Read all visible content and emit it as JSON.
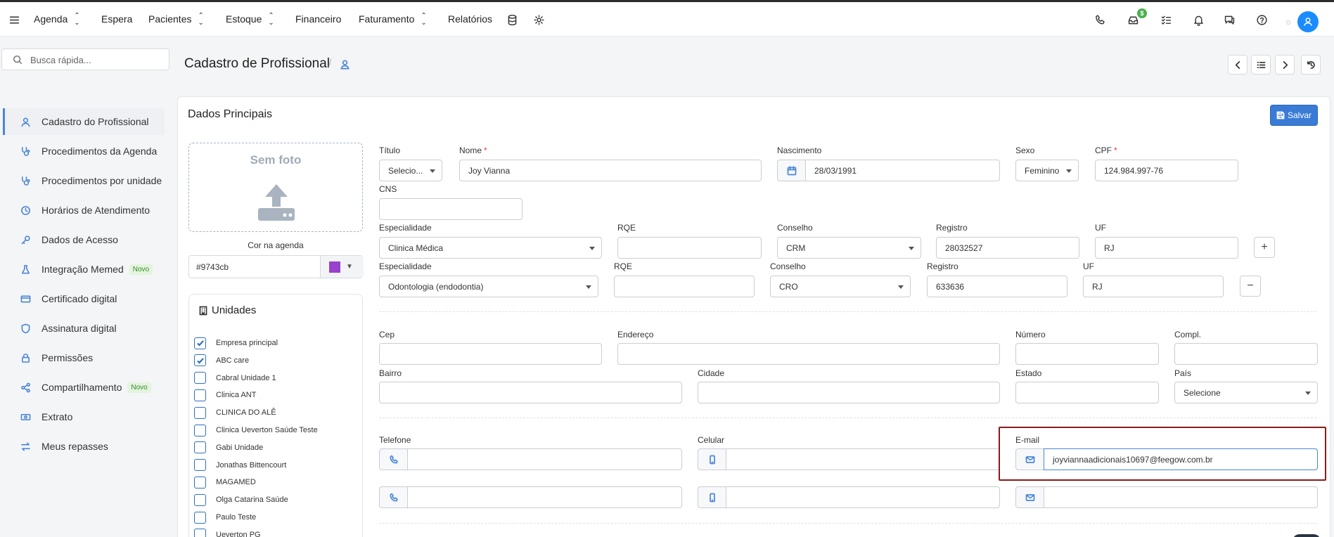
{
  "nav": {
    "items": [
      {
        "label": "Agenda",
        "dropdown": true
      },
      {
        "label": "Espera",
        "dropdown": false
      },
      {
        "label": "Pacientes",
        "dropdown": true
      },
      {
        "label": "Estoque",
        "dropdown": true
      },
      {
        "label": "Financeiro",
        "dropdown": false
      },
      {
        "label": "Faturamento",
        "dropdown": true
      },
      {
        "label": "Relatórios",
        "dropdown": false
      }
    ],
    "dollar_badge": "$"
  },
  "search": {
    "placeholder": "Busca rápida..."
  },
  "page": {
    "title": "Cadastro de Profissional",
    "separator": "/"
  },
  "sidebar": {
    "items": [
      {
        "label": "Cadastro do Profissional",
        "active": true,
        "badge": ""
      },
      {
        "label": "Procedimentos da Agenda",
        "badge": ""
      },
      {
        "label": "Procedimentos por unidade",
        "badge": ""
      },
      {
        "label": "Horários de Atendimento",
        "badge": ""
      },
      {
        "label": "Dados de Acesso",
        "badge": ""
      },
      {
        "label": "Integração Memed",
        "badge": "Novo"
      },
      {
        "label": "Certificado digital",
        "badge": ""
      },
      {
        "label": "Assinatura digital",
        "badge": ""
      },
      {
        "label": "Permissões",
        "badge": ""
      },
      {
        "label": "Compartilhamento",
        "badge": "Novo"
      },
      {
        "label": "Extrato",
        "badge": ""
      },
      {
        "label": "Meus repasses",
        "badge": ""
      }
    ]
  },
  "section": {
    "title": "Dados Principais",
    "save_label": "Salvar"
  },
  "photo": {
    "placeholder": "Sem foto"
  },
  "color": {
    "label": "Cor na agenda",
    "value": "#9743cb",
    "swatch": "#9743cb"
  },
  "units": {
    "title": "Unidades",
    "items": [
      {
        "label": "Empresa principal",
        "checked": true
      },
      {
        "label": "ABC care",
        "checked": true
      },
      {
        "label": "Cabral Unidade 1",
        "checked": false
      },
      {
        "label": "Clinica ANT",
        "checked": false
      },
      {
        "label": "CLINICA DO ALÊ",
        "checked": false
      },
      {
        "label": "Clinica Ueverton Saúde Teste",
        "checked": false
      },
      {
        "label": "Gabi Unidade",
        "checked": false
      },
      {
        "label": "Jonathas Bittencourt",
        "checked": false
      },
      {
        "label": "MAGAMED",
        "checked": false
      },
      {
        "label": "Olga Catarina Saúde",
        "checked": false
      },
      {
        "label": "Paulo Teste",
        "checked": false
      },
      {
        "label": "Ueverton PG",
        "checked": false
      }
    ]
  },
  "form": {
    "titulo": {
      "label": "Título",
      "value": "Selecio..."
    },
    "nome": {
      "label": "Nome",
      "value": "Joy Vianna",
      "required": "*"
    },
    "nascimento": {
      "label": "Nascimento",
      "value": "28/03/1991"
    },
    "sexo": {
      "label": "Sexo",
      "value": "Feminino"
    },
    "cpf": {
      "label": "CPF",
      "value": "124.984.997-76",
      "required": "*"
    },
    "cns": {
      "label": "CNS",
      "value": ""
    },
    "esp1": {
      "label": "Especialidade",
      "value": "Clinica Médica",
      "rqe_label": "RQE",
      "rqe": "",
      "conselho_label": "Conselho",
      "conselho": "CRM",
      "registro_label": "Registro",
      "registro": "28032527",
      "uf_label": "UF",
      "uf": "RJ",
      "action": "+"
    },
    "esp2": {
      "label": "Especialidade",
      "value": "Odontologia (endodontia)",
      "rqe_label": "RQE",
      "rqe": "",
      "conselho_label": "Conselho",
      "conselho": "CRO",
      "registro_label": "Registro",
      "registro": "633636",
      "uf_label": "UF",
      "uf": "RJ",
      "action": "−"
    },
    "cep": {
      "label": "Cep",
      "value": ""
    },
    "endereco": {
      "label": "Endereço",
      "value": ""
    },
    "numero": {
      "label": "Número",
      "value": ""
    },
    "compl": {
      "label": "Compl.",
      "value": ""
    },
    "bairro": {
      "label": "Bairro",
      "value": ""
    },
    "cidade": {
      "label": "Cidade",
      "value": ""
    },
    "estado": {
      "label": "Estado",
      "value": ""
    },
    "pais": {
      "label": "País",
      "value": "Selecione"
    },
    "telefone": {
      "label": "Telefone",
      "value": "",
      "value2": ""
    },
    "celular": {
      "label": "Celular",
      "value": "",
      "value2": ""
    },
    "email": {
      "label": "E-mail",
      "value": "joyviannaadicionais10697@feegow.com.br",
      "value2": ""
    }
  },
  "colors": {
    "accent": "#4a86d6",
    "save": "#3a7bd5",
    "highlight": "#8b1a1a",
    "avatar": "#1a8cff"
  }
}
